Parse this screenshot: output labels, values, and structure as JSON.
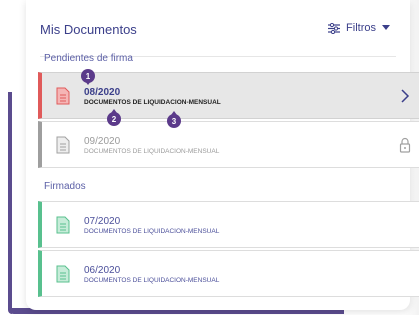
{
  "header": {
    "title": "Mis Documentos",
    "filters_label": "Filtros",
    "filters_icon": "sliders-icon",
    "dropdown_icon": "caret-down-icon"
  },
  "sections": {
    "pending_label": "Pendientes de firma",
    "signed_label": "Firmados"
  },
  "pending_docs": [
    {
      "period": "08/2020",
      "description": "DOCUMENTOS DE LIQUIDACION-MENSUAL",
      "status_color": "#e05a5a",
      "action_icon": "chevron-right-icon",
      "state": "active"
    },
    {
      "period": "09/2020",
      "description": "DOCUMENTOS DE LIQUIDACION-MENSUAL",
      "status_color": "#9e9e9e",
      "action_icon": "lock-icon",
      "state": "locked"
    }
  ],
  "signed_docs": [
    {
      "period": "07/2020",
      "description": "DOCUMENTOS DE LIQUIDACION-MENSUAL",
      "status_color": "#58c08e"
    },
    {
      "period": "06/2020",
      "description": "DOCUMENTOS DE LIQUIDACION-MENSUAL",
      "status_color": "#58c08e"
    }
  ],
  "callouts": [
    "1",
    "2",
    "3"
  ],
  "colors": {
    "accent": "#3b3f8a",
    "frame": "#5b4c8e",
    "callout": "#5b3a8a"
  }
}
